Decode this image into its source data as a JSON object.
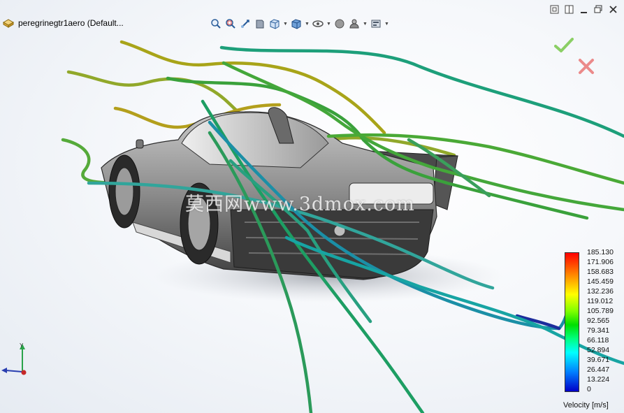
{
  "document": {
    "title": "peregrinegtr1aero  (Default..."
  },
  "heads_up_toolbar": {
    "icons": [
      "zoom-to-fit-icon",
      "zoom-to-area-icon",
      "previous-view-icon",
      "section-view-icon",
      "view-orientation-icon",
      "display-style-icon",
      "hide-show-items-icon",
      "edit-appearance-icon",
      "apply-scene-icon",
      "view-settings-icon"
    ]
  },
  "window_controls": [
    "restore-icon",
    "tile-icon",
    "minimize-icon",
    "close-icon"
  ],
  "confirmation_corner": {
    "accept_color": "#7ac943",
    "cancel_color": "#e87c7c"
  },
  "legend": {
    "title": "Velocity [m/s]",
    "ticks": [
      "185.130",
      "171.906",
      "158.683",
      "145.459",
      "132.236",
      "119.012",
      "105.789",
      "92.565",
      "79.341",
      "66.118",
      "52.894",
      "39.671",
      "26.447",
      "13.224",
      "0"
    ]
  },
  "watermark": "莫西网www.3dmox.com",
  "colors": {
    "car_body": "#8e8e8e",
    "car_dark": "#3a3a3a",
    "shadow": "#b4b8c0"
  }
}
